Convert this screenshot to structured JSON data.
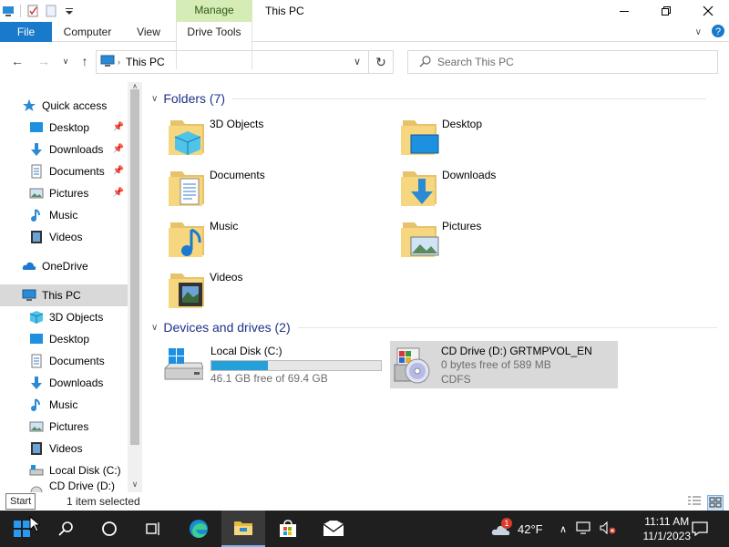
{
  "window": {
    "title": "This PC",
    "manage_tab": "Manage"
  },
  "ribbon": {
    "tabs": [
      "File",
      "Computer",
      "View",
      "Drive Tools"
    ]
  },
  "address": {
    "path": "This PC",
    "search_placeholder": "Search This PC"
  },
  "sidebar": {
    "quick_access": "Quick access",
    "quick_items": [
      "Desktop",
      "Downloads",
      "Documents",
      "Pictures",
      "Music",
      "Videos"
    ],
    "onedrive": "OneDrive",
    "this_pc": "This PC",
    "pc_items": [
      "3D Objects",
      "Desktop",
      "Documents",
      "Downloads",
      "Music",
      "Pictures",
      "Videos",
      "Local Disk (C:)"
    ],
    "partial_item": "CD Drive (D:) GR"
  },
  "folders": {
    "header": "Folders (7)",
    "items": [
      "3D Objects",
      "Desktop",
      "Documents",
      "Downloads",
      "Music",
      "Pictures",
      "Videos"
    ]
  },
  "devices": {
    "header": "Devices and drives (2)",
    "items": [
      {
        "name": "Local Disk (C:)",
        "free_text": "46.1 GB free of 69.4 GB",
        "used_fraction": 0.336
      },
      {
        "name": "CD Drive (D:) GRTMPVOL_EN",
        "free_text": "0 bytes free of 589 MB",
        "fs": "CDFS"
      }
    ]
  },
  "status": {
    "selection": "1 item selected",
    "tooltip": "Start"
  },
  "taskbar": {
    "weather_temp": "42°F",
    "weather_badge": "1",
    "time": "11:11 AM",
    "date": "11/1/2023"
  },
  "colors": {
    "accent": "#1979ca",
    "manage_bg": "#d5ecb6",
    "progress": "#26a0da",
    "taskbar": "#1f1f1f",
    "header_text": "#1e3287"
  }
}
